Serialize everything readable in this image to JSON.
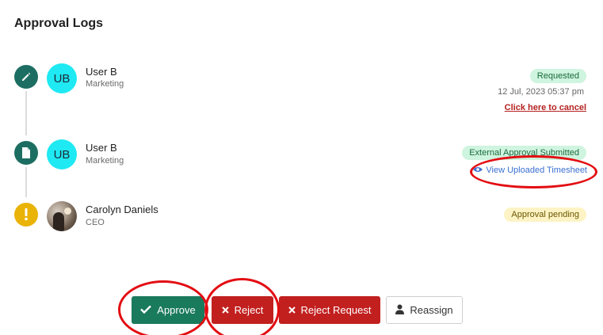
{
  "page": {
    "title": "Approval Logs"
  },
  "logs": [
    {
      "avatar_initials": "UB",
      "name": "User B",
      "department": "Marketing",
      "status": "Requested",
      "timestamp": "12 Jul, 2023 05:37 pm",
      "action_link": "Click here to cancel",
      "icon": "pencil-icon"
    },
    {
      "avatar_initials": "UB",
      "name": "User B",
      "department": "Marketing",
      "status": "External Approval Submitted",
      "action_link": "View Uploaded Timesheet",
      "icon": "file-icon"
    },
    {
      "name": "Carolyn Daniels",
      "department": "CEO",
      "status": "Approval pending",
      "icon": "exclamation-icon"
    }
  ],
  "actions": {
    "approve": "Approve",
    "reject": "Reject",
    "reject_request": "Reject Request",
    "reassign": "Reassign"
  },
  "colors": {
    "teal_icon": "#1d6e62",
    "pending_icon": "#e9b308",
    "approve": "#1a7a5c",
    "reject": "#c1201f",
    "annotation": "#e30d12"
  }
}
